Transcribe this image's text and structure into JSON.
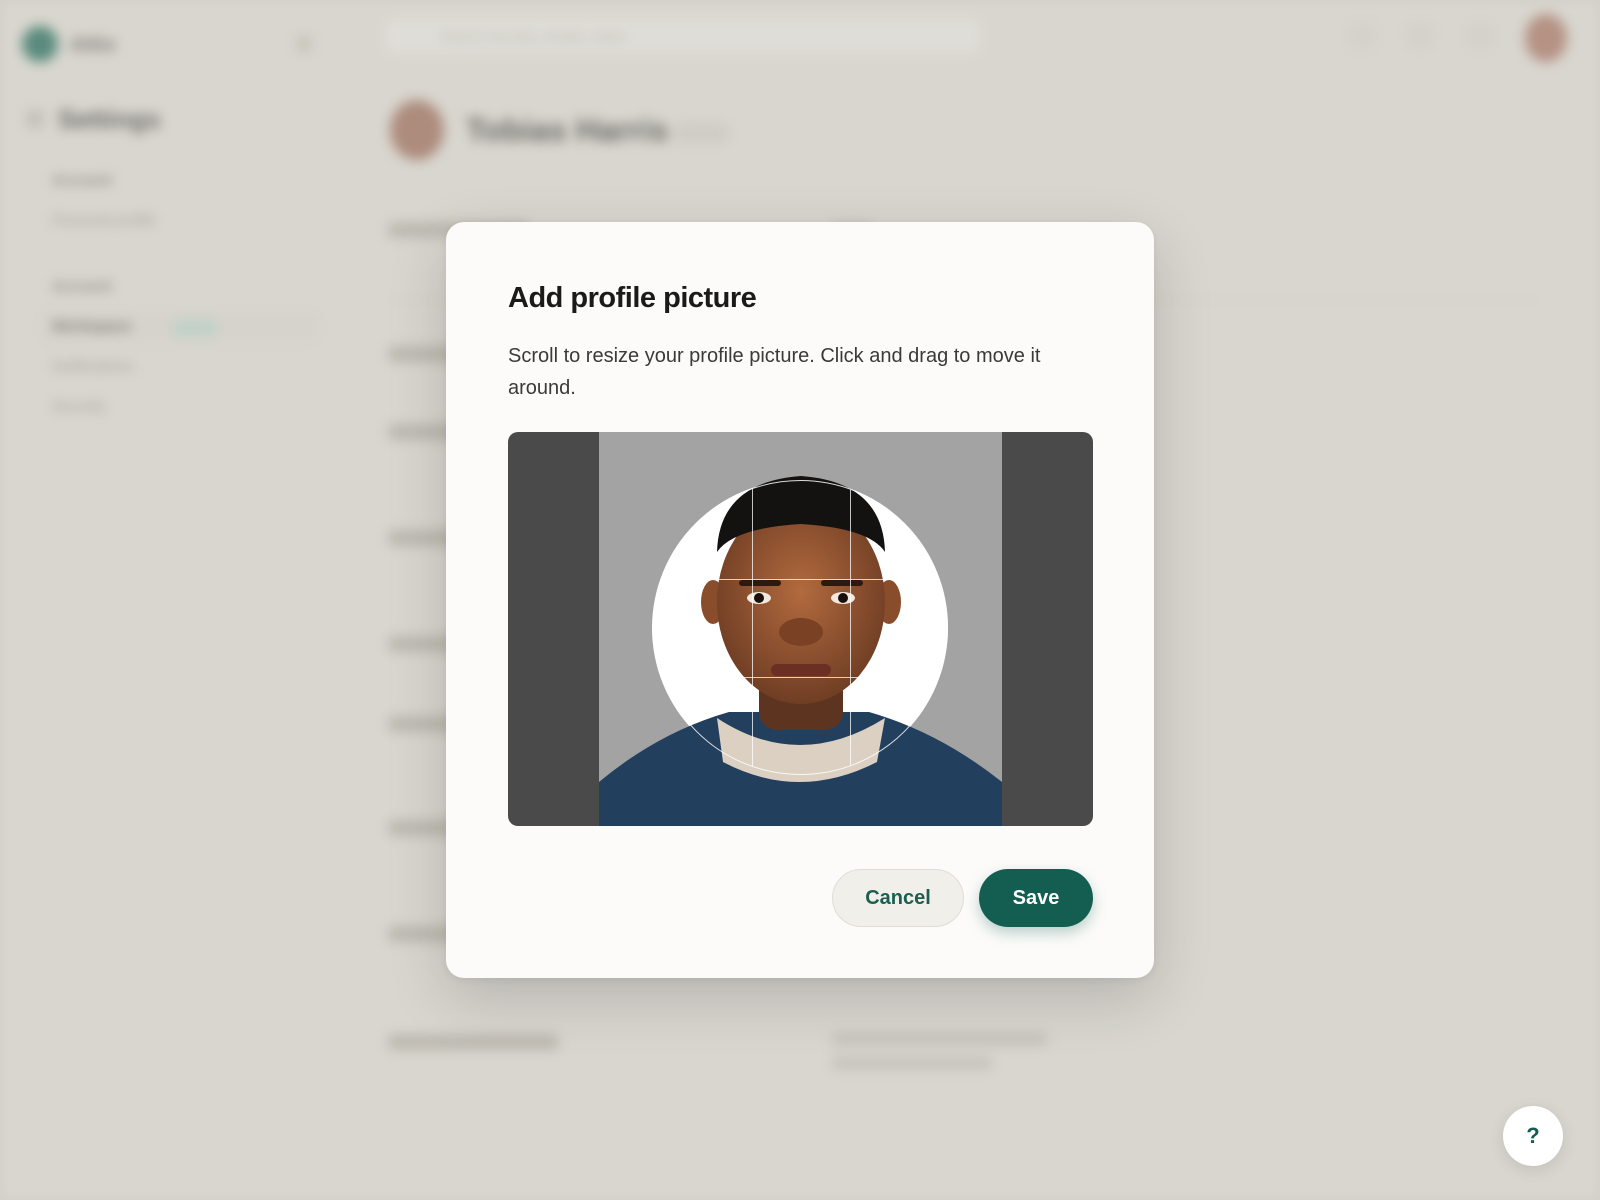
{
  "background": {
    "app_name": "Attio",
    "search_placeholder": "Search records, emails, notes",
    "sidebar": {
      "title": "Settings",
      "sections": [
        {
          "label": "Account",
          "items": [
            "Personal profile"
          ]
        },
        {
          "label": "Account",
          "items": [
            "Workspace",
            "Notifications",
            "Security"
          ]
        }
      ]
    },
    "profile_name": "Tobias Harris"
  },
  "modal": {
    "title": "Add profile picture",
    "description": "Scroll to resize your profile picture. Click and drag to move it around.",
    "cancel_label": "Cancel",
    "save_label": "Save"
  },
  "help": {
    "label": "?"
  },
  "colors": {
    "accent": "#135e51",
    "backdrop": "#dcd9d2",
    "modal_bg": "#fcfbf9"
  }
}
